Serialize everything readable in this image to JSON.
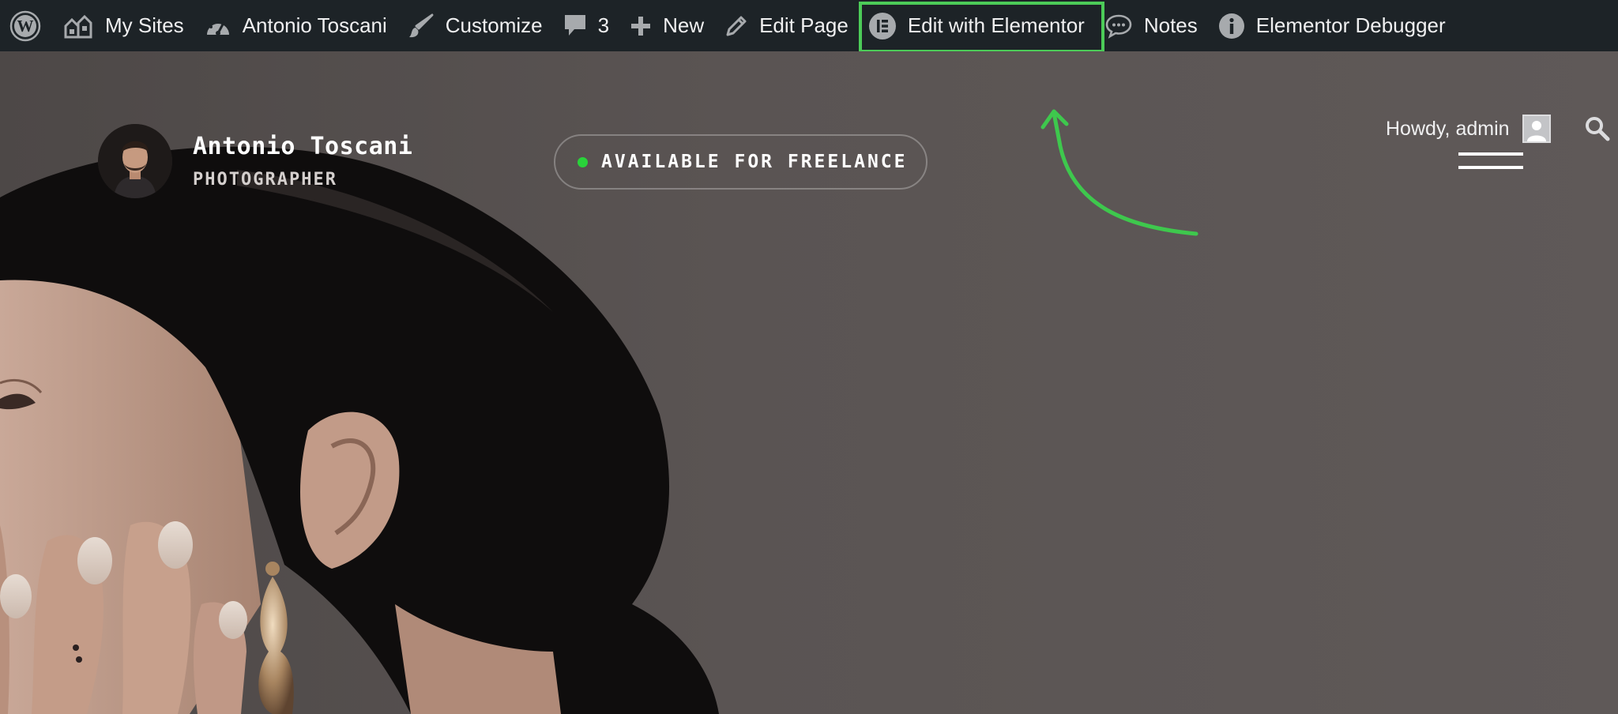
{
  "adminbar": {
    "items": [
      {
        "id": "wp",
        "icon": "wordpress-logo-icon",
        "label": ""
      },
      {
        "id": "my_sites",
        "icon": "my-sites-icon",
        "label": "My Sites"
      },
      {
        "id": "site",
        "icon": "dashboard-gauge-icon",
        "label": "Antonio Toscani"
      },
      {
        "id": "customize",
        "icon": "paintbrush-icon",
        "label": "Customize"
      },
      {
        "id": "comments",
        "icon": "comment-bubble-icon",
        "label": "3"
      },
      {
        "id": "new",
        "icon": "plus-icon",
        "label": "New"
      },
      {
        "id": "edit_page",
        "icon": "pencil-icon",
        "label": "Edit Page"
      },
      {
        "id": "elementor",
        "icon": "elementor-logo-icon",
        "label": "Edit with Elementor"
      },
      {
        "id": "notes",
        "icon": "speech-bubble-icon",
        "label": "Notes"
      },
      {
        "id": "debugger",
        "icon": "info-icon",
        "label": "Elementor Debugger"
      }
    ],
    "howdy": "Howdy, admin"
  },
  "site": {
    "name": "Antonio Toscani",
    "role": "PHOTOGRAPHER",
    "freelance_badge": "AVAILABLE FOR FREELANCE"
  },
  "colors": {
    "adminbar_bg": "#1d2327",
    "highlight": "#4ccb58",
    "status_dot": "#29d33a"
  }
}
